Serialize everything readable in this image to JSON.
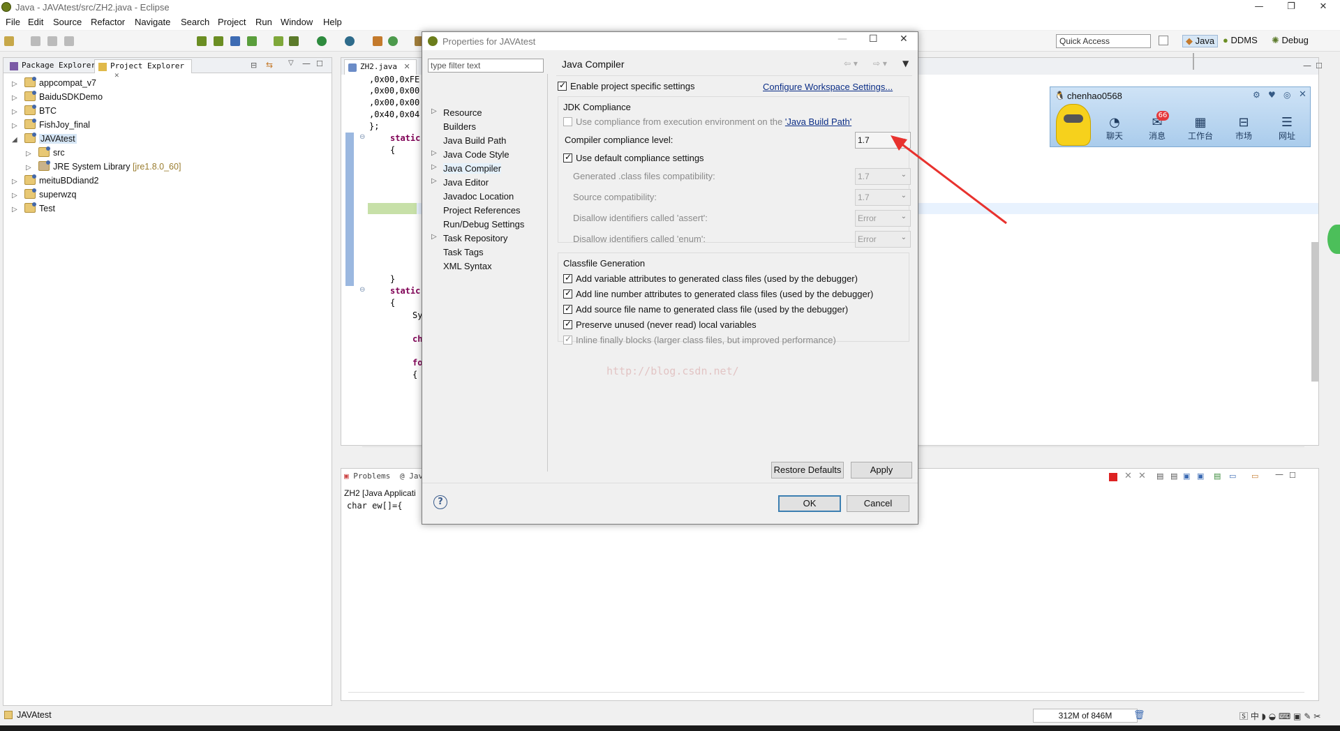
{
  "window": {
    "title": "Java - JAVAtest/src/ZH2.java - Eclipse"
  },
  "menu": [
    "File",
    "Edit",
    "Source",
    "Refactor",
    "Navigate",
    "Search",
    "Project",
    "Run",
    "Window",
    "Help"
  ],
  "toolbar": {
    "quick_access_placeholder": "Quick Access",
    "perspectives": [
      "Java",
      "DDMS",
      "Debug"
    ]
  },
  "left_panel": {
    "tabs": [
      "Package Explorer",
      "Project Explorer"
    ],
    "tree": [
      {
        "label": "appcompat_v7",
        "level": 0,
        "expanded": false
      },
      {
        "label": "BaiduSDKDemo",
        "level": 0,
        "expanded": false
      },
      {
        "label": "BTC",
        "level": 0,
        "expanded": false
      },
      {
        "label": "FishJoy_final",
        "level": 0,
        "expanded": false
      },
      {
        "label": "JAVAtest",
        "level": 0,
        "expanded": true,
        "selected": true
      },
      {
        "label": "src",
        "level": 1,
        "expanded": false
      },
      {
        "label": "JRE System Library",
        "decoration": "[jre1.8.0_60]",
        "level": 1,
        "expanded": false
      },
      {
        "label": "meituBDdiand2",
        "level": 0,
        "expanded": false
      },
      {
        "label": "superwzq",
        "level": 0,
        "expanded": false
      },
      {
        "label": "Test",
        "level": 0,
        "expanded": false
      }
    ]
  },
  "editor": {
    "tab": "ZH2.java",
    "lines": [
      ",0x00,0xFE",
      ",0x00,0x00",
      ",0x00,0x00",
      ",0x40,0x04",
      "};",
      "static",
      "{",
      "}",
      "static",
      "{",
      "Sy",
      "ch",
      "fo",
      "{"
    ]
  },
  "console": {
    "tabs": [
      "Problems",
      "Jav"
    ],
    "header": "ZH2 [Java Applicati",
    "output": "char ew[]={"
  },
  "status": {
    "selection": "JAVAtest",
    "heap": "312M of 846M"
  },
  "dialog": {
    "title": "Properties for JAVAtest",
    "filter_placeholder": "type filter text",
    "nav": [
      {
        "label": "Resource",
        "expandable": true
      },
      {
        "label": "Builders",
        "expandable": false
      },
      {
        "label": "Java Build Path",
        "expandable": false
      },
      {
        "label": "Java Code Style",
        "expandable": true
      },
      {
        "label": "Java Compiler",
        "expandable": true,
        "selected": true
      },
      {
        "label": "Java Editor",
        "expandable": true
      },
      {
        "label": "Javadoc Location",
        "expandable": false
      },
      {
        "label": "Project References",
        "expandable": false
      },
      {
        "label": "Run/Debug Settings",
        "expandable": false
      },
      {
        "label": "Task Repository",
        "expandable": true
      },
      {
        "label": "Task Tags",
        "expandable": false
      },
      {
        "label": "XML Syntax",
        "expandable": false
      }
    ],
    "page_title": "Java Compiler",
    "enable_project_settings": "Enable project specific settings",
    "configure_link": "Configure Workspace Settings...",
    "jdk_group": "JDK Compliance",
    "use_env_compliance_prefix": "Use compliance from execution environment on the ",
    "use_env_compliance_link": "'Java Build Path'",
    "compliance_level_label": "Compiler compliance level:",
    "compliance_level_value": "1.7",
    "use_default_compliance": "Use default compliance settings",
    "generated_compat_label": "Generated .class files compatibility:",
    "generated_compat_value": "1.7",
    "source_compat_label": "Source compatibility:",
    "source_compat_value": "1.7",
    "assert_label": "Disallow identifiers called 'assert':",
    "assert_value": "Error",
    "enum_label": "Disallow identifiers called 'enum':",
    "enum_value": "Error",
    "classfile_group": "Classfile Generation",
    "classfile_options": [
      {
        "label": "Add variable attributes to generated class files (used by the debugger)",
        "checked": true,
        "enabled": true
      },
      {
        "label": "Add line number attributes to generated class files (used by the debugger)",
        "checked": true,
        "enabled": true
      },
      {
        "label": "Add source file name to generated class file (used by the debugger)",
        "checked": true,
        "enabled": true
      },
      {
        "label": "Preserve unused (never read) local variables",
        "checked": true,
        "enabled": true
      },
      {
        "label": "Inline finally blocks (larger class files, but improved performance)",
        "checked": true,
        "enabled": false
      }
    ],
    "watermark": "http://blog.csdn.net/",
    "restore_defaults": "Restore Defaults",
    "apply": "Apply",
    "ok": "OK",
    "cancel": "Cancel"
  },
  "qq_widget": {
    "user": "chenhao0568",
    "badge": "66",
    "items": [
      "聊天",
      "消息",
      "工作台",
      "市场",
      "网址"
    ]
  }
}
